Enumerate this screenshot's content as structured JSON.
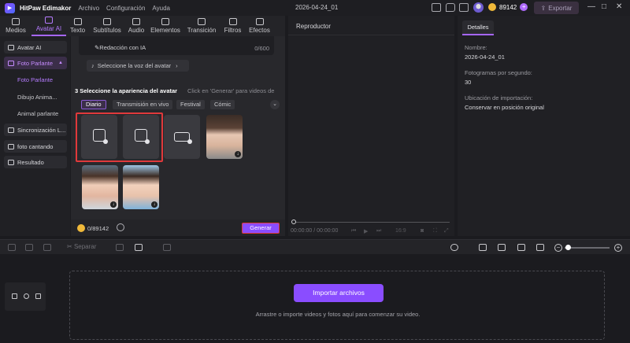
{
  "titlebar": {
    "app_name": "HitPaw Edimakor",
    "menu": [
      "Archivo",
      "Configuración",
      "Ayuda"
    ],
    "doc_title": "2026-04-24_01",
    "credits": "89142",
    "export_label": "Exportar"
  },
  "tools": [
    {
      "label": "Medios",
      "icon": "media-icon"
    },
    {
      "label": "Avatar AI",
      "icon": "avatar-icon"
    },
    {
      "label": "Texto",
      "icon": "text-icon"
    },
    {
      "label": "Subtítulos",
      "icon": "subtitle-icon"
    },
    {
      "label": "Audio",
      "icon": "audio-icon"
    },
    {
      "label": "Elementos",
      "icon": "elements-icon"
    },
    {
      "label": "Transición",
      "icon": "transition-icon"
    },
    {
      "label": "Filtros",
      "icon": "filters-icon"
    },
    {
      "label": "Efectos",
      "icon": "effects-icon"
    }
  ],
  "sidebar": {
    "items": [
      {
        "label": "Avatar AI"
      },
      {
        "label": "Foto Parlante"
      },
      {
        "label": "Sincronización L..."
      },
      {
        "label": "foto cantando"
      },
      {
        "label": "Resultado"
      }
    ],
    "subitems": [
      "Foto Parlante",
      "Dibujo Anima...",
      "Animal parlante"
    ]
  },
  "panel": {
    "char_count": "0/600",
    "rewrite_label": "Redacción con IA",
    "voice_button": "Seleccione la voz del avatar",
    "section_title": "3 Seleccione la apariencia del avatar",
    "section_hint": "Click en 'Generar' para videos de",
    "categories": [
      "Diario",
      "Transmisión en vivo",
      "Festival",
      "Cómic"
    ],
    "credit_use": "0/89142",
    "generate_label": "Generar"
  },
  "player": {
    "title": "Reproductor",
    "timecode": "00:00:00 / 00:00:00",
    "ratio": "16:9"
  },
  "details": {
    "tab": "Detalles",
    "fields": [
      {
        "label": "Nombre:",
        "value": "2026-04-24_01"
      },
      {
        "label": "Fotogramas por segundo:",
        "value": "30"
      },
      {
        "label": "Ubicación de importación:",
        "value": "Conservar en posición original"
      }
    ]
  },
  "timeline": {
    "split_label": "Separar"
  },
  "track": {
    "import_label": "Importar archivos",
    "drop_hint": "Arrastre o importe videos y fotos aquí para comenzar su video."
  },
  "colors": {
    "accent": "#8a4dff",
    "highlight": "#e0393b",
    "coin": "#f0b93a"
  }
}
